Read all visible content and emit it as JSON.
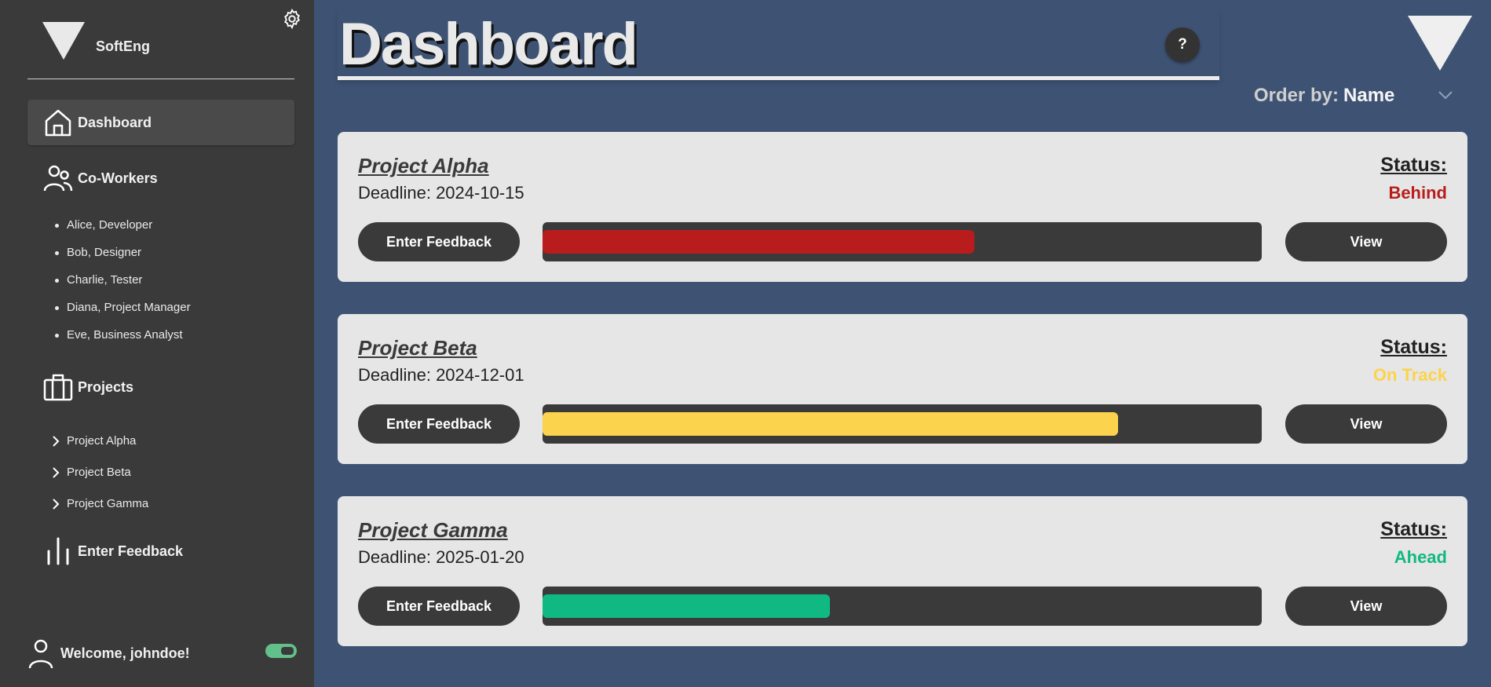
{
  "brand": {
    "name": "SoftEng"
  },
  "nav": {
    "dashboard": "Dashboard",
    "coworkers": "Co-Workers",
    "projects": "Projects",
    "feedback": "Enter Feedback"
  },
  "coworkers": [
    "Alice, Developer",
    "Bob, Designer",
    "Charlie, Tester",
    "Diana, Project Manager",
    "Eve, Business Analyst"
  ],
  "project_links": [
    "Project Alpha",
    "Project Beta",
    "Project Gamma"
  ],
  "user": {
    "welcome": "Welcome, johndoe!"
  },
  "header": {
    "title": "Dashboard",
    "help": "?",
    "order_label": "Order by:",
    "order_value": "Name"
  },
  "cards": [
    {
      "name": "Project Alpha",
      "deadline": "Deadline: 2024-10-15",
      "status_label": "Status:",
      "status": "Behind",
      "status_color": "#b91c1c",
      "progress": 0.6,
      "feedback_btn": "Enter Feedback",
      "view_btn": "View"
    },
    {
      "name": "Project Beta",
      "deadline": "Deadline: 2024-12-01",
      "status_label": "Status:",
      "status": "On Track",
      "status_color": "#fcd34d",
      "progress": 0.8,
      "feedback_btn": "Enter Feedback",
      "view_btn": "View"
    },
    {
      "name": "Project Gamma",
      "deadline": "Deadline: 2025-01-20",
      "status_label": "Status:",
      "status": "Ahead",
      "status_color": "#10b981",
      "progress": 0.4,
      "feedback_btn": "Enter Feedback",
      "view_btn": "View"
    }
  ]
}
